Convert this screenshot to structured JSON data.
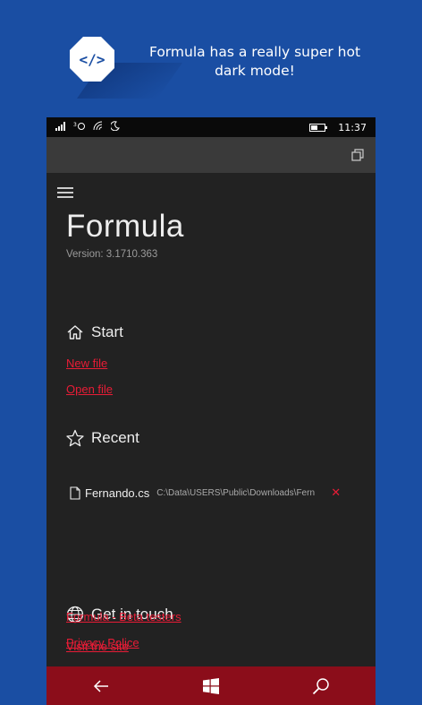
{
  "promo": {
    "logo_glyph": "</>",
    "tagline": "Formula has a really super hot dark mode!"
  },
  "status_bar": {
    "time": "11:37",
    "icons": [
      "signal-icon",
      "network-icon",
      "wifi-icon",
      "quiet-hours-icon",
      "battery-icon"
    ]
  },
  "app": {
    "title": "Formula",
    "version": "Version: 3.1710.363"
  },
  "start": {
    "heading": "Start",
    "new_file": "New file",
    "open_file": "Open file"
  },
  "recent": {
    "heading": "Recent",
    "items": [
      {
        "name": "Fernando.cs",
        "path": "C:\\Data\\USERS\\Public\\Downloads\\Fern",
        "remove": "✕"
      }
    ]
  },
  "contact": {
    "heading": "Get in touch",
    "visit_site": "Visit the site",
    "beta": "Formula - Beta testers",
    "privacy": "Privacy Police"
  },
  "colors": {
    "background": "#1a4ea3",
    "accent": "#e81c36",
    "navbar": "#8b0d1a",
    "phone_bg": "#222222"
  }
}
